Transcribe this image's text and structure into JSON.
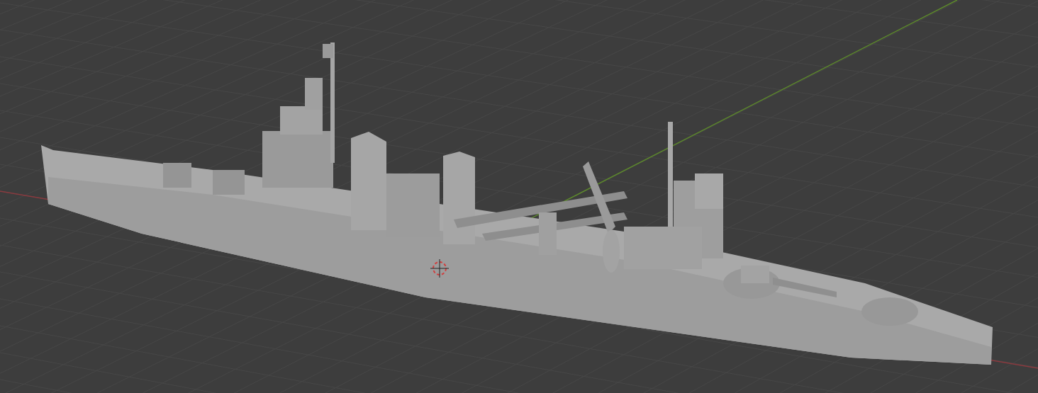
{
  "viewport": {
    "show_grid": true,
    "show_axes": true,
    "show_3d_cursor": true,
    "show_model": true
  }
}
